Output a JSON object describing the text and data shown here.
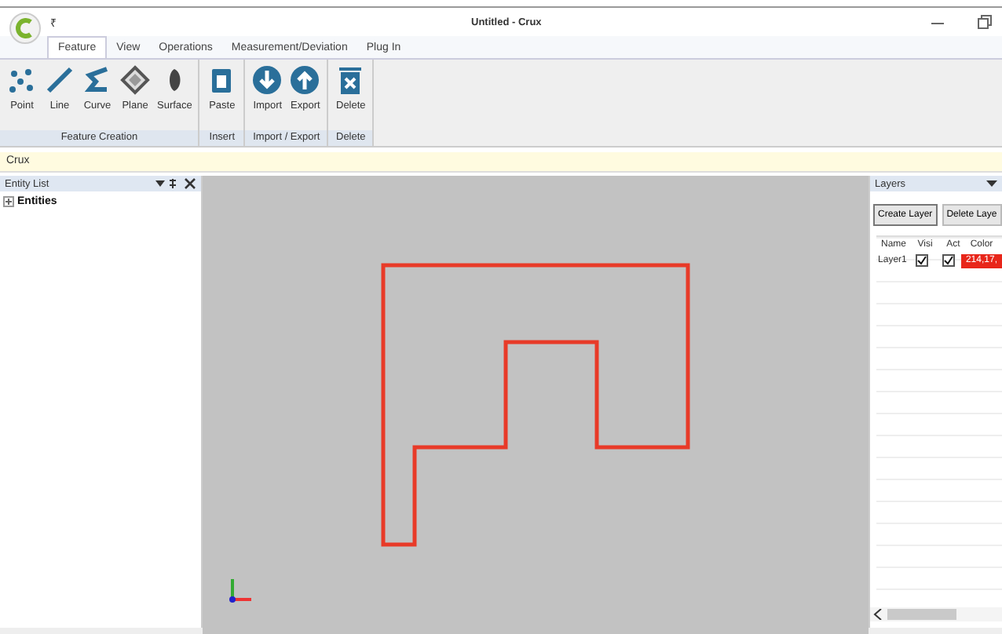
{
  "window": {
    "title": "Untitled - Crux",
    "quick_access": "₹"
  },
  "tabs": [
    {
      "label": "Feature",
      "selected": true
    },
    {
      "label": "View",
      "selected": false
    },
    {
      "label": "Operations",
      "selected": false
    },
    {
      "label": "Measurement/Deviation",
      "selected": false
    },
    {
      "label": "Plug In",
      "selected": false
    }
  ],
  "ribbon_groups": [
    {
      "label": "Feature Creation",
      "buttons": [
        "Point",
        "Line",
        "Curve",
        "Plane",
        "Surface"
      ]
    },
    {
      "label": "Insert",
      "buttons": [
        "Paste"
      ]
    },
    {
      "label": "Import / Export",
      "buttons": [
        "Import",
        "Export"
      ]
    },
    {
      "label": "Delete",
      "buttons": [
        "Delete"
      ]
    }
  ],
  "breadcrumb": "Crux",
  "entity_panel": {
    "title": "Entity List",
    "tree": [
      {
        "label": "Entities",
        "expanded": false
      }
    ]
  },
  "layers_panel": {
    "title": "Layers",
    "buttons": [
      "Create Layer",
      "Delete Laye"
    ],
    "columns": [
      "Name",
      "Visi",
      "Act",
      "Color"
    ],
    "rows": [
      {
        "name": "Layer1",
        "visible": true,
        "active": true,
        "color_text": "214,17,",
        "color": "#e8261a"
      }
    ]
  }
}
